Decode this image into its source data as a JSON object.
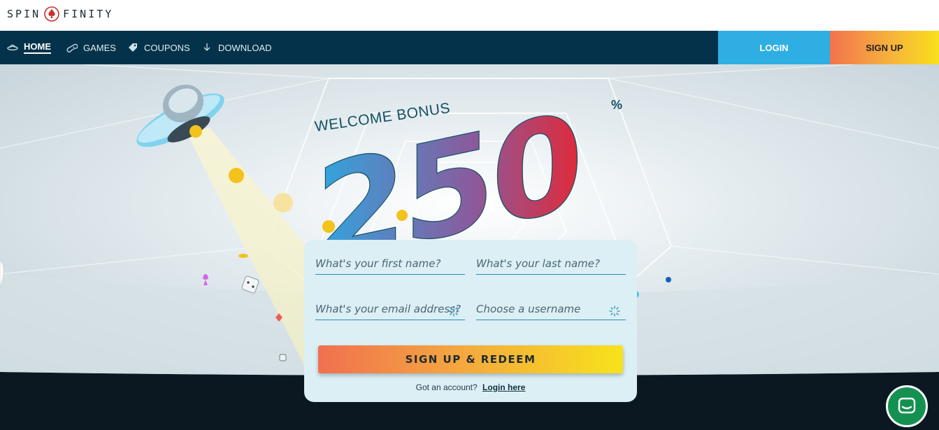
{
  "brand": {
    "logo_left": "SPIN",
    "logo_right": "FINITY"
  },
  "nav": {
    "items": [
      {
        "label": "HOME",
        "icon": "ufo-icon",
        "active": true
      },
      {
        "label": "GAMES",
        "icon": "gamepad-icon",
        "active": false
      },
      {
        "label": "COUPONS",
        "icon": "coupon-icon",
        "active": false
      },
      {
        "label": "DOWNLOAD",
        "icon": "download-icon",
        "active": false
      }
    ],
    "login_label": "LOGIN",
    "signup_label": "SIGN UP"
  },
  "hero": {
    "welcome_text": "WELCOME BONUS",
    "bonus_value": "250",
    "bonus_unit": "%"
  },
  "form": {
    "first_name_placeholder": "What's your first name?",
    "last_name_placeholder": "What's your last name?",
    "email_placeholder": "What's your email address?",
    "username_placeholder": "Choose a username",
    "submit_label": "SIGN UP & REDEEM",
    "account_prompt": "Got an account?",
    "login_link": "Login here"
  },
  "colors": {
    "nav_bg": "#04324a",
    "login_bg": "#2eaee3",
    "signup_gradient_start": "#f2734e",
    "signup_gradient_end": "#f8e01a",
    "card_bg": "#dbeff5",
    "chat_bg": "#149150"
  },
  "icons": {
    "chat": "chat-bubble-icon"
  }
}
